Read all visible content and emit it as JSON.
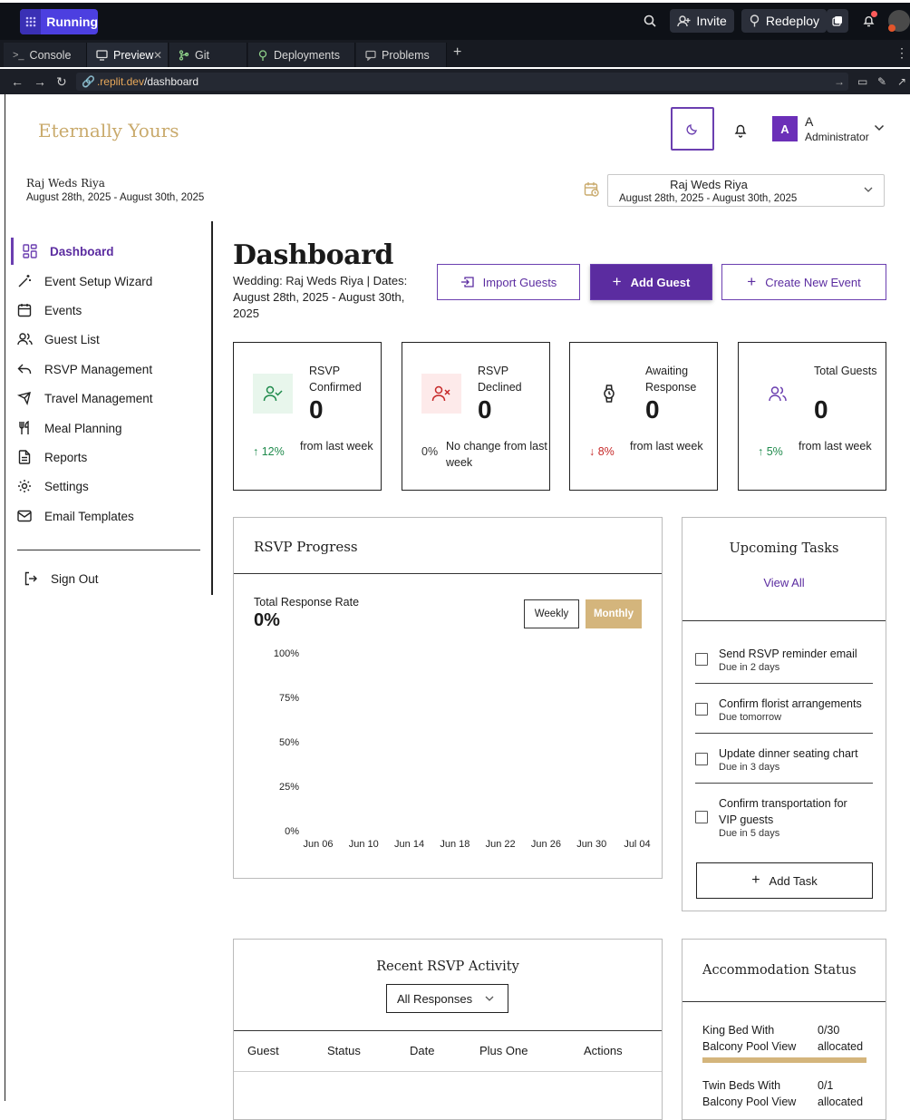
{
  "chrome": {
    "run_label": "Running",
    "invite_label": "Invite",
    "redeploy_label": "Redeploy",
    "tabs": [
      "Console",
      "Preview",
      "Git",
      "Deployments",
      "Problems"
    ],
    "url_host": ".replit.dev",
    "url_path": "/dashboard"
  },
  "app": {
    "brand": "Eternally Yours",
    "user_initial": "A",
    "user_name": "A",
    "user_role": "Administrator",
    "event_title": "Raj Weds Riya",
    "event_dates": "August 28th, 2025 - August 30th, 2025",
    "select_title": "Raj Weds Riya",
    "select_dates": "August 28th, 2025 - August 30th, 2025"
  },
  "sidebar": {
    "items": [
      {
        "label": "Dashboard",
        "icon": "dashboard-icon"
      },
      {
        "label": "Event Setup Wizard",
        "icon": "wand-icon"
      },
      {
        "label": "Events",
        "icon": "calendar-icon"
      },
      {
        "label": "Guest List",
        "icon": "users-icon"
      },
      {
        "label": "RSVP Management",
        "icon": "reply-icon"
      },
      {
        "label": "Travel Management",
        "icon": "plane-icon"
      },
      {
        "label": "Meal Planning",
        "icon": "utensils-icon"
      },
      {
        "label": "Reports",
        "icon": "file-icon"
      },
      {
        "label": "Settings",
        "icon": "gear-icon"
      },
      {
        "label": "Email Templates",
        "icon": "mail-icon"
      }
    ],
    "sign_out": "Sign Out"
  },
  "main": {
    "title": "Dashboard",
    "subtitle": "Wedding: Raj Weds Riya | Dates: August 28th, 2025 - August 30th, 2025",
    "import_label": "Import Guests",
    "add_label": "Add Guest",
    "create_label": "Create New Event"
  },
  "stats": [
    {
      "label": "RSVP Confirmed",
      "value": "0",
      "change": "12%",
      "change_text": "from last week",
      "trend": "up"
    },
    {
      "label": "RSVP Declined",
      "value": "0",
      "change": "0%",
      "change_text": "No change from last week",
      "trend": "none"
    },
    {
      "label": "Awaiting Response",
      "value": "0",
      "change": "8%",
      "change_text": "from last week",
      "trend": "down"
    },
    {
      "label": "Total Guests",
      "value": "0",
      "change": "5%",
      "change_text": "from last week",
      "trend": "up"
    }
  ],
  "rsvp_progress": {
    "title": "RSVP Progress",
    "rate_label": "Total Response Rate",
    "rate_value": "0%",
    "weekly": "Weekly",
    "monthly": "Monthly"
  },
  "chart_data": {
    "type": "line",
    "x": [
      "Jun 06",
      "Jun 10",
      "Jun 14",
      "Jun 18",
      "Jun 22",
      "Jun 26",
      "Jun 30",
      "Jul 04"
    ],
    "y_ticks": [
      "100%",
      "75%",
      "50%",
      "25%",
      "0%"
    ],
    "ylim": [
      0,
      100
    ],
    "series": []
  },
  "tasks": {
    "title": "Upcoming Tasks",
    "view_all": "View All",
    "items": [
      {
        "title": "Send RSVP reminder email",
        "due": "Due in 2 days"
      },
      {
        "title": "Confirm florist arrangements",
        "due": "Due tomorrow"
      },
      {
        "title": "Update dinner seating chart",
        "due": "Due in 3 days"
      },
      {
        "title": "Confirm transportation for VIP guests",
        "due": "Due in 5 days"
      }
    ],
    "add_label": "Add Task"
  },
  "recent": {
    "title": "Recent RSVP Activity",
    "filter": "All Responses",
    "columns": [
      "Guest",
      "Status",
      "Date",
      "Plus One",
      "Actions"
    ]
  },
  "accommodation": {
    "title": "Accommodation Status",
    "rooms": [
      {
        "name": "King Bed With Balcony Pool View",
        "count": "0/30 allocated",
        "fill": 0
      },
      {
        "name": "Twin Beds With Balcony Pool View",
        "count": "0/1 allocated",
        "fill": 0
      }
    ]
  },
  "colors": {
    "brand": "#c9aa6c",
    "primary": "#5b2ca0",
    "up": "#1f8a4c",
    "down": "#c62828"
  }
}
